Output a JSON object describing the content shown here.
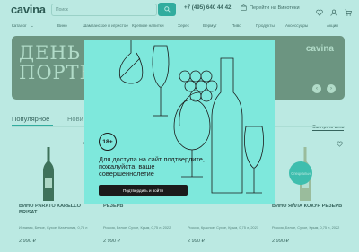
{
  "header": {
    "logo": "cavina",
    "search_placeholder": "Поиск",
    "phone": "+7 (495) 640 44 42",
    "vinoteka": "Перейти на Винотеки"
  },
  "nav": {
    "items": [
      "Каталог",
      "Вино",
      "Шампанское и игристое",
      "Крепкие напитки",
      "Херес",
      "Вермут",
      "Пиво",
      "Продукты",
      "Аксессуары",
      "Акции"
    ]
  },
  "banner": {
    "title_line1": "ДЕНЬ",
    "title_line2": "ПОРТВЕ",
    "logo": "cavina",
    "prev": "‹",
    "next": "›"
  },
  "tabs": {
    "popular": "Популярное",
    "new": "Нови",
    "see_all": "Смотреть весь"
  },
  "products": [
    {
      "name": "ВИНО PARATO XARELLO BRISAT",
      "badge": "",
      "desc": "Испания, Белое, Сухое, Каталония, 0,75 л",
      "price": "2 990 ₽",
      "bottle_color": "#2f3a1e"
    },
    {
      "name": "РЕЗЕРВ",
      "badge": "",
      "desc": "Россия, Белое, Сухое, Крым, 0,75 л, 2022",
      "price": "2 990 ₽",
      "bottle_color": "#3e2a1d"
    },
    {
      "name": "",
      "badge": "",
      "desc": "Россия, Красное, Сухое, Крым, 0,75 л, 2021",
      "price": "2 990 ₽",
      "bottle_color": "#3a2418"
    },
    {
      "name": "ВИНО ЯЙЛА КОКУР РЕЗЕРВ",
      "badge": "",
      "desc": "Россия, Белое, Сухое, Крым, 0,75 л, 2022",
      "price": "2 990 ₽",
      "bottle_color": "#c9b48a",
      "special": "Специальн"
    }
  ],
  "modal": {
    "age": "18+",
    "text": "Для доступа на сайт подтвердите, пожалуйста, ваше совершеннолетие",
    "button": "Подтвердить и войти"
  },
  "colors": {
    "accent": "#1a9a8e",
    "modal_bg": "#7ee8dc",
    "banner_bg": "#7c745e"
  }
}
